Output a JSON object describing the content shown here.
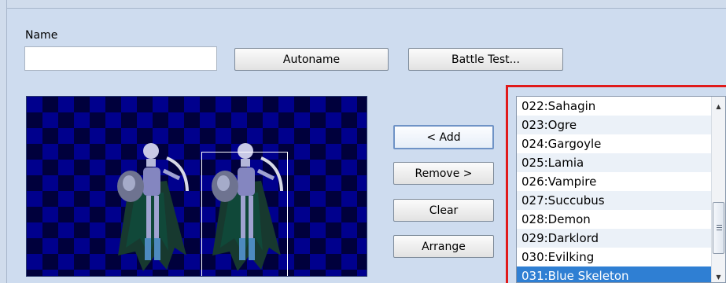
{
  "form": {
    "name_label": "Name",
    "name_value": "",
    "autoname_label": "Autoname",
    "battle_test_label": "Battle Test..."
  },
  "actions": {
    "add_label": "< Add",
    "remove_label": "Remove >",
    "clear_label": "Clear",
    "arrange_label": "Arrange"
  },
  "enemy_list": {
    "items": [
      "022:Sahagin",
      "023:Ogre",
      "024:Gargoyle",
      "025:Lamia",
      "026:Vampire",
      "027:Succubus",
      "028:Demon",
      "029:Darklord",
      "030:Evilking",
      "031:Blue Skeleton"
    ],
    "selected": "031:Blue Skeleton"
  },
  "colors": {
    "highlight_border": "#e01a1a",
    "selection": "#2f7fd3"
  }
}
